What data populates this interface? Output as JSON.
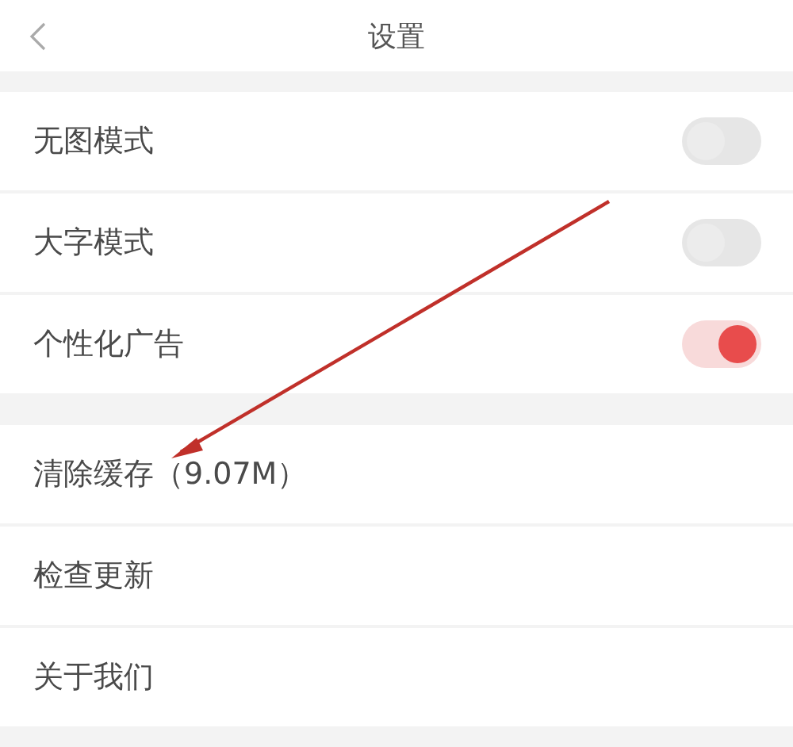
{
  "header": {
    "title": "设置"
  },
  "groups": [
    {
      "items": [
        {
          "kind": "toggle",
          "label": "无图模式",
          "on": false
        },
        {
          "kind": "toggle",
          "label": "大字模式",
          "on": false
        },
        {
          "kind": "toggle",
          "label": "个性化广告",
          "on": true
        }
      ]
    },
    {
      "items": [
        {
          "kind": "link",
          "label": "清除缓存（9.07M）"
        },
        {
          "kind": "link",
          "label": "检查更新"
        },
        {
          "kind": "link",
          "label": "关于我们"
        }
      ]
    }
  ]
}
